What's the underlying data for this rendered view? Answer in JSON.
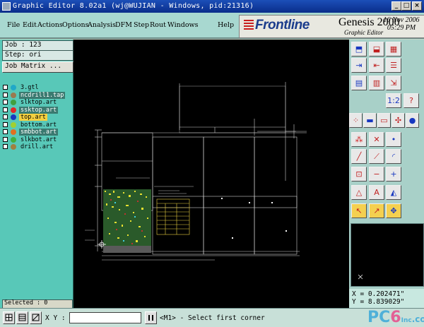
{
  "window": {
    "title": "Graphic Editor 8.02a1 (wj@WUJIAN - Windows, pid:21316)",
    "min_label": "_",
    "max_label": "□",
    "close_label": "×"
  },
  "menu": {
    "items": [
      "File",
      "Edit",
      "Actions",
      "Options",
      "Analysis",
      "DFM",
      "Step",
      "Rout",
      "Windows"
    ],
    "help": "Help"
  },
  "logo": {
    "brand": "Frontline",
    "product": "Genesis 2000",
    "subtitle": "Graphic Editor",
    "date": "16 Nov 2006",
    "time": "05:29 PM"
  },
  "job": {
    "job_text": "Job : 123",
    "step_text": "Step: ori",
    "matrix_button": "Job Matrix ..."
  },
  "layers": [
    {
      "name": "3.gtl",
      "color": "#20a8c8",
      "highlight": ""
    },
    {
      "name": "ncdrill1.tap",
      "color": "#9a7a50",
      "highlight": "#3a7a70"
    },
    {
      "name": "slktop.art",
      "color": "#40a040",
      "highlight": ""
    },
    {
      "name": "ssktop.art",
      "color": "#e02828",
      "highlight": "#3a7a70"
    },
    {
      "name": "top.art",
      "color": "#1838c0",
      "highlight": "#f4d040"
    },
    {
      "name": "bottom.art",
      "color": "#a0d030",
      "highlight": ""
    },
    {
      "name": "smbbot.art",
      "color": "#e07020",
      "highlight": "#3a7a70"
    },
    {
      "name": "slkbot.art",
      "color": "#40b040",
      "highlight": ""
    },
    {
      "name": "drill.art",
      "color": "#a08040",
      "highlight": ""
    }
  ],
  "selected_text": "Selected : 0",
  "toolbox": {
    "icons": [
      "open-icon",
      "save-icon",
      "grid-icon",
      "step-in-icon",
      "step-out-icon",
      "list-icon",
      "table-icon",
      "layers-icon",
      "scale-icon",
      "number-icon",
      "question-icon",
      "connect-icon",
      "dash-icon",
      "ruler-icon",
      "network-icon",
      "circle-icon",
      "connect-red-icon",
      "cross-icon",
      "dot-icon",
      "line-icon",
      "diagonal-icon",
      "arc-icon",
      "pad-icon",
      "minus-icon",
      "plus-icon",
      "triangle-icon",
      "a-text-icon",
      "shape-icon",
      "pointer-icon",
      "select-icon",
      "move-icon"
    ],
    "highlight_color": "#f4d050"
  },
  "coords": {
    "x_text": "X = 0.202471\"",
    "y_text": "Y = 8.839029\""
  },
  "bottom": {
    "xy_label": "X Y :",
    "status": "<M1> - Select first corner"
  },
  "watermark": {
    "text_a": "PC",
    "text_b": "6",
    "text_c": "Inc",
    "text_d": ".com"
  }
}
